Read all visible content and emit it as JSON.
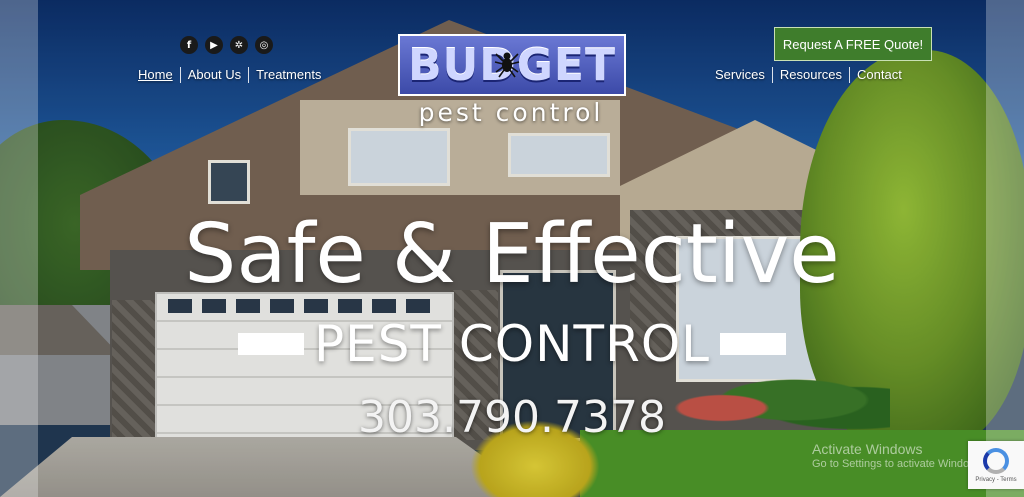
{
  "social": {
    "icons": [
      "facebook-icon",
      "youtube-icon",
      "yelp-icon",
      "instagram-icon"
    ],
    "glyphs": [
      "f",
      "▶",
      "✲",
      "◎"
    ]
  },
  "nav_left": [
    {
      "label": "Home",
      "active": true
    },
    {
      "label": "About Us"
    },
    {
      "label": "Treatments"
    }
  ],
  "nav_right": [
    {
      "label": "Services"
    },
    {
      "label": "Resources"
    },
    {
      "label": "Contact"
    }
  ],
  "logo": {
    "main": "BUDGET",
    "sub": "pest control"
  },
  "cta": {
    "label": "Request A FREE Quote!",
    "color": "#3f7d2c"
  },
  "hero": {
    "title": "Safe & Effective",
    "subtitle": "PEST CONTROL",
    "phone": "303.790.7378"
  },
  "watermark": {
    "line1": "Activate Windows",
    "line2": "Go to Settings to activate Windows."
  },
  "recaptcha": {
    "text": "Privacy - Terms"
  },
  "colors": {
    "brand_blue": "#4b59c0",
    "accent_green": "#3f7d2c"
  }
}
